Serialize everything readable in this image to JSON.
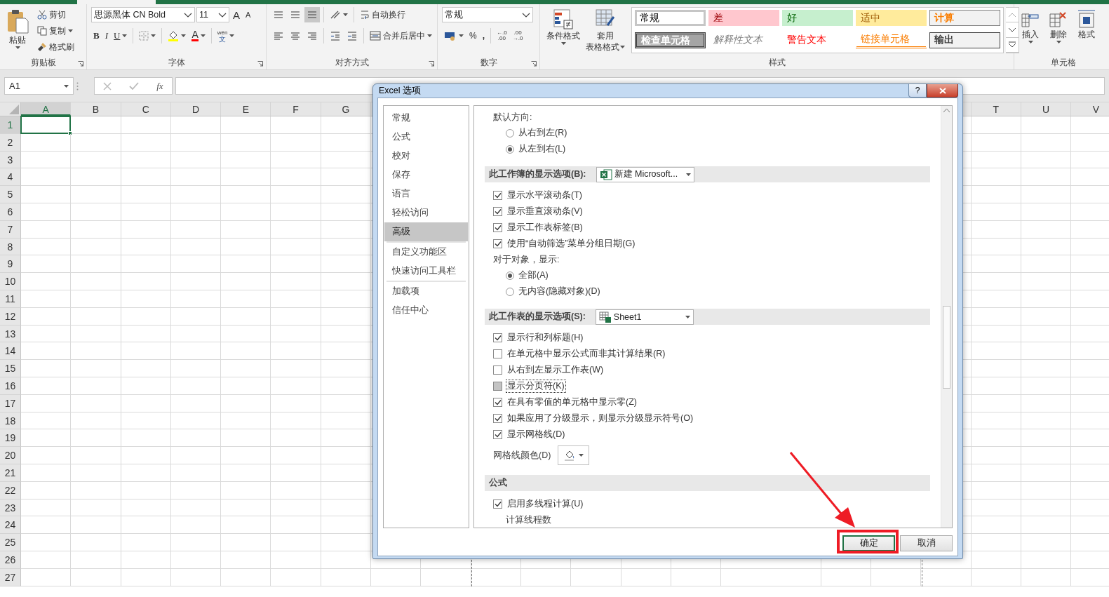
{
  "ribbon": {
    "clipboard": {
      "paste": "粘贴",
      "cut": "剪切",
      "copy": "复制",
      "format_painter": "格式刷",
      "label": "剪贴板"
    },
    "font": {
      "name": "思源黑体 CN Bold",
      "size": "11",
      "grow": "A",
      "shrink": "A",
      "bold": "B",
      "italic": "I",
      "underline": "U",
      "font_color": "A",
      "phonetic": "wén",
      "phonetic_char": "文",
      "label": "字体"
    },
    "alignment": {
      "wrap": "自动换行",
      "merge": "合并后居中",
      "label": "对齐方式"
    },
    "number": {
      "format": "常规",
      "percent": "%",
      "comma": ",",
      "add_decimal": [
        "←.0",
        ".00"
      ],
      "remove_decimal": [
        ".00",
        "→.0"
      ],
      "label": "数字"
    },
    "styles": {
      "conditional": "条件格式",
      "table_format": [
        "套用",
        "表格格式"
      ],
      "label": "样式",
      "gallery": [
        {
          "text": "常规",
          "kind": "normal",
          "selected": true
        },
        {
          "text": "差",
          "kind": "bad",
          "selected": false
        },
        {
          "text": "好",
          "kind": "good",
          "selected": false
        },
        {
          "text": "适中",
          "kind": "neutral",
          "selected": false
        },
        {
          "text": "计算",
          "kind": "calculation",
          "selected": false
        },
        {
          "text": "检查单元格",
          "kind": "check",
          "selected": false
        },
        {
          "text": "解释性文本",
          "kind": "explanatory",
          "selected": false
        },
        {
          "text": "警告文本",
          "kind": "warning",
          "selected": false
        },
        {
          "text": "链接单元格",
          "kind": "linked",
          "selected": false
        },
        {
          "text": "输出",
          "kind": "output",
          "selected": false
        }
      ]
    },
    "cells": {
      "insert": "插入",
      "delete": "删除",
      "format": "格式",
      "label": "单元格"
    }
  },
  "formula_bar": {
    "name_box": "A1",
    "fx": "fx"
  },
  "grid": {
    "columns_left": [
      {
        "label": "A",
        "selected": true
      },
      {
        "label": "B",
        "selected": false
      },
      {
        "label": "C",
        "selected": false
      },
      {
        "label": "D",
        "selected": false
      },
      {
        "label": "E",
        "selected": false
      },
      {
        "label": "F",
        "selected": false
      },
      {
        "label": "G",
        "selected": false
      }
    ],
    "columns_right": [
      {
        "label": "T",
        "selected": false
      },
      {
        "label": "U",
        "selected": false
      },
      {
        "label": "V",
        "selected": false
      }
    ],
    "rows": [
      {
        "label": "1",
        "selected": true
      },
      {
        "label": "2",
        "selected": false
      },
      {
        "label": "3",
        "selected": false
      },
      {
        "label": "4",
        "selected": false
      },
      {
        "label": "5",
        "selected": false
      },
      {
        "label": "6",
        "selected": false
      },
      {
        "label": "7",
        "selected": false
      },
      {
        "label": "8",
        "selected": false
      },
      {
        "label": "9",
        "selected": false
      },
      {
        "label": "10",
        "selected": false
      },
      {
        "label": "11",
        "selected": false
      },
      {
        "label": "12",
        "selected": false
      },
      {
        "label": "13",
        "selected": false
      },
      {
        "label": "14",
        "selected": false
      },
      {
        "label": "15",
        "selected": false
      },
      {
        "label": "16",
        "selected": false
      },
      {
        "label": "17",
        "selected": false
      },
      {
        "label": "18",
        "selected": false
      },
      {
        "label": "19",
        "selected": false
      },
      {
        "label": "20",
        "selected": false
      },
      {
        "label": "21",
        "selected": false
      },
      {
        "label": "22",
        "selected": false
      },
      {
        "label": "23",
        "selected": false
      },
      {
        "label": "24",
        "selected": false
      },
      {
        "label": "25",
        "selected": false
      },
      {
        "label": "26",
        "selected": false
      },
      {
        "label": "27",
        "selected": false
      }
    ]
  },
  "dialog": {
    "title": "Excel 选项",
    "help": "?",
    "nav": [
      {
        "label": "常规",
        "selected": false,
        "separator_after": false
      },
      {
        "label": "公式",
        "selected": false,
        "separator_after": false
      },
      {
        "label": "校对",
        "selected": false,
        "separator_after": false
      },
      {
        "label": "保存",
        "selected": false,
        "separator_after": false
      },
      {
        "label": "语言",
        "selected": false,
        "separator_after": false
      },
      {
        "label": "轻松访问",
        "selected": false,
        "separator_after": false
      },
      {
        "label": "高级",
        "selected": true,
        "separator_after": true
      },
      {
        "label": "自定义功能区",
        "selected": false,
        "separator_after": false
      },
      {
        "label": "快速访问工具栏",
        "selected": false,
        "separator_after": true
      },
      {
        "label": "加载项",
        "selected": false,
        "separator_after": false
      },
      {
        "label": "信任中心",
        "selected": false,
        "separator_after": false
      }
    ],
    "options": [
      {
        "kind": "label",
        "text": "默认方向:"
      },
      {
        "kind": "radio",
        "text": "从右到左(R)",
        "selected": false
      },
      {
        "kind": "radio",
        "text": "从左到右(L)",
        "selected": true
      },
      {
        "kind": "workbook-section",
        "text": "此工作簿的显示选项(B):",
        "dropdown": "新建 Microsoft..."
      },
      {
        "kind": "checkbox",
        "text": "显示水平滚动条(T)",
        "checked": true,
        "focused": false,
        "shaded": false
      },
      {
        "kind": "checkbox",
        "text": "显示垂直滚动条(V)",
        "checked": true,
        "focused": false,
        "shaded": false
      },
      {
        "kind": "checkbox",
        "text": "显示工作表标签(B)",
        "checked": true,
        "focused": false,
        "shaded": false
      },
      {
        "kind": "checkbox",
        "text": "使用“自动筛选”菜单分组日期(G)",
        "checked": true,
        "focused": false,
        "shaded": false
      },
      {
        "kind": "label",
        "text": "对于对象，显示:"
      },
      {
        "kind": "radio",
        "text": "全部(A)",
        "selected": true
      },
      {
        "kind": "radio",
        "text": "无内容(隐藏对象)(D)",
        "selected": false
      },
      {
        "kind": "sheet-section",
        "text": "此工作表的显示选项(S):",
        "dropdown": "Sheet1"
      },
      {
        "kind": "checkbox",
        "text": "显示行和列标题(H)",
        "checked": true,
        "focused": false,
        "shaded": false
      },
      {
        "kind": "checkbox",
        "text": "在单元格中显示公式而非其计算结果(R)",
        "checked": false,
        "focused": false,
        "shaded": false
      },
      {
        "kind": "checkbox",
        "text": "从右到左显示工作表(W)",
        "checked": false,
        "focused": false,
        "shaded": false
      },
      {
        "kind": "checkbox",
        "text": "显示分页符(K)",
        "checked": false,
        "focused": true,
        "shaded": true
      },
      {
        "kind": "checkbox",
        "text": "在具有零值的单元格中显示零(Z)",
        "checked": true,
        "focused": false,
        "shaded": false
      },
      {
        "kind": "checkbox",
        "text": "如果应用了分级显示，则显示分级显示符号(O)",
        "checked": true,
        "focused": false,
        "shaded": false
      },
      {
        "kind": "checkbox",
        "text": "显示网格线(D)",
        "checked": true,
        "focused": false,
        "shaded": false
      },
      {
        "kind": "color",
        "text": "网格线颜色(D)"
      },
      {
        "kind": "section",
        "text": "公式"
      },
      {
        "kind": "checkbox",
        "text": "启用多线程计算(U)",
        "checked": true,
        "focused": false,
        "shaded": false
      },
      {
        "kind": "sublabel",
        "text": "计算线程数"
      }
    ],
    "buttons": [
      {
        "label": "确定",
        "default": true
      },
      {
        "label": "取消",
        "default": false
      }
    ]
  }
}
